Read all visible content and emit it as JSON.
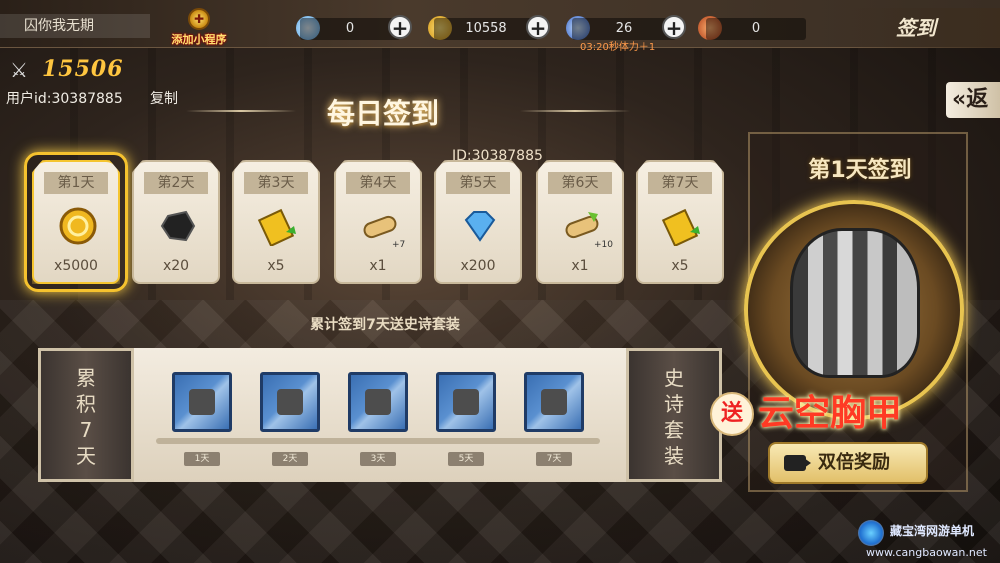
{
  "topbar": {
    "player_name": "囚你我无期",
    "mini_program_label": "添加小程序",
    "diamonds": "0",
    "gold": "10558",
    "stamina": "26",
    "stamina_timer": "03:20秒体力＋1",
    "token": "0",
    "plus_symbol": "+",
    "page_title": "签到"
  },
  "player": {
    "power": "15506",
    "user_id": "用户id:30387885",
    "copy_label": "复制",
    "back_label": "返"
  },
  "signin": {
    "heading": "每日签到",
    "id_text": "ID:30387885",
    "days": [
      {
        "label": "第1天",
        "qty": "x5000",
        "icon": "gold-coin-icon",
        "active": true
      },
      {
        "label": "第2天",
        "qty": "x20",
        "icon": "ore-icon"
      },
      {
        "label": "第3天",
        "qty": "x5",
        "icon": "ticket-icon"
      },
      {
        "label": "第4天",
        "qty": "x1",
        "icon": "scroll-icon",
        "badge": "+7"
      },
      {
        "label": "第5天",
        "qty": "x200",
        "icon": "diamond-icon"
      },
      {
        "label": "第6天",
        "qty": "x1",
        "icon": "scroll-icon",
        "badge": "+10"
      },
      {
        "label": "第7天",
        "qty": "x5",
        "icon": "ticket-icon"
      }
    ]
  },
  "cumulative": {
    "title": "累计签到7天送史诗套装",
    "left_label": "累积7天",
    "right_label": "史诗套装",
    "ticks": [
      "1天",
      "2天",
      "3天",
      "5天",
      "7天"
    ],
    "slots": [
      "helmet-icon",
      "gauntlet-icon",
      "weapon-icon",
      "armor-piece-icon",
      "boots-icon"
    ]
  },
  "featured": {
    "title": "第1天签到",
    "gift_label": "送",
    "reward_name": "云空胸甲",
    "double_button": "双倍奖励"
  },
  "watermark": {
    "cn": "藏宝湾网游单机",
    "url": "www.cangbaowan.net"
  },
  "colors": {
    "accent_gold": "#f5c22e",
    "reward_red": "#ff3a24",
    "card_bg": "#f6efe2"
  }
}
